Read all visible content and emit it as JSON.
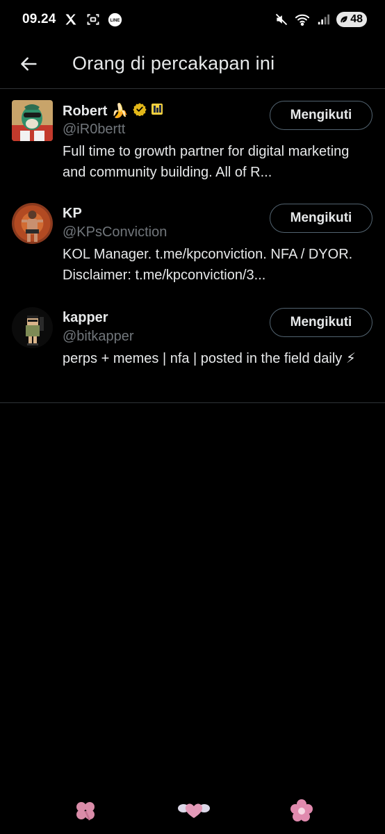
{
  "status_bar": {
    "time": "09.24",
    "battery": "48",
    "left_icons": [
      "x-logo-icon",
      "scan-icon",
      "line-app-icon"
    ],
    "right_icons": [
      "mute-icon",
      "wifi-icon",
      "signal-icon",
      "battery-icon"
    ]
  },
  "header": {
    "back_icon": "arrow-left-icon",
    "title": "Orang di percakapan ini"
  },
  "people": [
    {
      "name": "Robert 🍌",
      "handle": "@iR0bertt",
      "verified": true,
      "bio": "Full time to growth partner for digital marketing and community building. All of R...",
      "follow_label": "Mengikuti"
    },
    {
      "name": "KP",
      "handle": "@KPsConviction",
      "verified": false,
      "bio": "KOL Manager. t.me/kpconviction. NFA / DYOR. Disclaimer: t.me/kpconviction/3...",
      "follow_label": "Mengikuti"
    },
    {
      "name": "kapper",
      "handle": "@bitkapper",
      "verified": false,
      "bio": "perps + memes | nfa | posted in the field daily ⚡",
      "follow_label": "Mengikuti"
    }
  ],
  "bottom_decor": [
    "clover-icon",
    "winged-heart-icon",
    "flower-icon"
  ],
  "colors": {
    "background": "#000000",
    "text_primary": "#e7e9ea",
    "text_secondary": "#71767b",
    "divider": "#2f3336",
    "verified_badge": "#e2b719"
  }
}
